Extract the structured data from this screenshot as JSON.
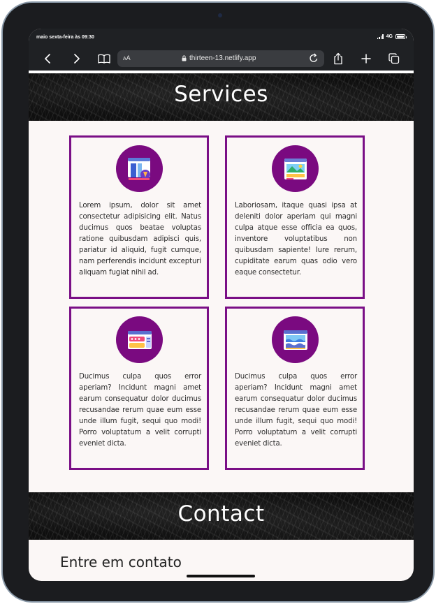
{
  "status_bar": {
    "time": "maio sexta-feira às 09:30",
    "network": "4G"
  },
  "browser": {
    "text_size_label": "AA",
    "url": "thirteen-13.netlify.app",
    "icons": [
      "back-icon",
      "forward-icon",
      "bookmarks-icon",
      "lock-icon",
      "reload-icon",
      "share-icon",
      "new-tab-icon",
      "tabs-icon"
    ]
  },
  "services": {
    "title": "Services",
    "cards": [
      {
        "icon": "design-tools-icon",
        "text": "Lorem ipsum, dolor sit amet consectetur adipisicing elit. Natus ducimus quos beatae voluptas ratione quibusdam adipisci quis, pariatur id aliquid, fugit cumque, nam perferendis incidunt excepturi aliquam fugiat nihil ad."
      },
      {
        "icon": "landscape-image-icon",
        "text": "Laboriosam, itaque quasi ipsa at deleniti dolor aperiam qui magni culpa atque esse officia ea quos, inventore voluptatibus non quibusdam sapiente! Iure rerum, cupiditate earum quas odio vero eaque consectetur."
      },
      {
        "icon": "web-form-icon",
        "text": "Ducimus culpa quos error aperiam? Incidunt magni amet earum consequatur dolor ducimus recusandae rerum quae eum esse unde illum fugit, sequi quo modi! Porro voluptatum a velit corrupti eveniet dicta."
      },
      {
        "icon": "browser-waves-icon",
        "text": "Ducimus culpa quos error aperiam? Incidunt magni amet earum consequatur dolor ducimus recusandae rerum quae eum esse unde illum fugit, sequi quo modi! Porro voluptatum a velit corrupti eveniet dicta."
      }
    ]
  },
  "contact": {
    "title": "Contact",
    "heading": "Entre em contato"
  },
  "colors": {
    "accent_purple": "#7a0f86",
    "banner_dark": "#0f0f0f",
    "page_bg": "#fbf7f6",
    "browser_chrome": "#1f2124"
  }
}
